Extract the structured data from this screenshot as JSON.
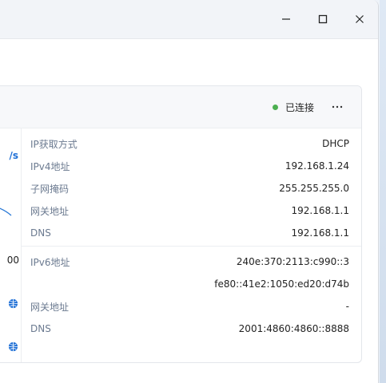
{
  "status": {
    "label": "已连接",
    "color": "#4caf50"
  },
  "left": {
    "speed_unit": "/s",
    "number": "00"
  },
  "ipv4": [
    {
      "key": "IP获取方式",
      "value": "DHCP"
    },
    {
      "key": "IPv4地址",
      "value": "192.168.1.24"
    },
    {
      "key": "子网掩码",
      "value": "255.255.255.0"
    },
    {
      "key": "网关地址",
      "value": "192.168.1.1"
    },
    {
      "key": "DNS",
      "value": "192.168.1.1"
    }
  ],
  "ipv6": [
    {
      "key": "IPv6地址",
      "value": "240e:370:2113:c990::3"
    },
    {
      "key": "",
      "value": "fe80::41e2:1050:ed20:d74b"
    },
    {
      "key": "网关地址",
      "value": "-"
    },
    {
      "key": "DNS",
      "value": "2001:4860:4860::8888"
    }
  ],
  "icons": {
    "more": "more-icon",
    "minimize": "minimize-icon",
    "maximize": "maximize-icon",
    "close": "close-icon",
    "globe": "globe-icon"
  }
}
